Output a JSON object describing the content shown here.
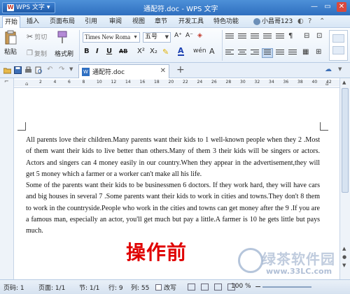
{
  "titlebar": {
    "app_menu_label": "WPS 文字",
    "window_title": "通配符.doc - WPS 文字",
    "controls": [
      "minimize-icon",
      "maximize-icon",
      "close-icon"
    ]
  },
  "menubar": {
    "items": [
      "开始",
      "插入",
      "页面布局",
      "引用",
      "审阅",
      "视图",
      "章节",
      "开发工具",
      "特色功能"
    ],
    "active": "开始",
    "user_name": "小昌哥123"
  },
  "ribbon": {
    "paste_label": "粘贴",
    "cut_label": "剪切",
    "copy_label": "复制",
    "format_painter_label": "格式刷",
    "font_name": "Times New Roma",
    "font_size": "五号",
    "format_buttons": [
      "B",
      "I",
      "U",
      "AB",
      "X²",
      "X₂"
    ]
  },
  "tabs": {
    "document_tab": "通配符.doc"
  },
  "ruler": {
    "ticks": [
      "2",
      "4",
      "6",
      "8",
      "10",
      "12",
      "14",
      "16",
      "18",
      "20",
      "22",
      "24",
      "26",
      "28",
      "30",
      "32",
      "34",
      "36",
      "38",
      "40",
      "42"
    ]
  },
  "document": {
    "paragraph1": "All parents love their children.Many parents want their kids to 1 well-known people when they 2 .Most of them want their kids to live better than others.Many of them 3 their kids will be singers or actors. Actors and singers can 4 money easily in our country.When they appear in the advertisement,they will get    5 money which a farmer or a worker can't make all his life.",
    "paragraph2": "Some of the parents want their kids to be businessmen 6    doctors. If they work hard, they will have cars and big houses in several 7 .Some parents want their kids to work in cities and towns.They don't    8 them to work in the countryside.People who work in the cities and towns can get money after the    9 .If you are a famous man, especially an actor, you'll get much but pay a little.A farmer is    10 he gets little but pays much.",
    "overlay_label": "操作前"
  },
  "statusbar": {
    "page": "页码: 1",
    "pages": "页面: 1/1",
    "section": "节: 1/1",
    "row": "行: 9",
    "column": "列: 55",
    "revision": "改写",
    "zoom": "100 %"
  },
  "watermark": {
    "name": "绿茶软件园",
    "url": "www.33LC.com"
  },
  "colors": {
    "title_bar": "#3a7dcc",
    "overlay_text": "#e00000",
    "accent": "#2f6fbf"
  }
}
